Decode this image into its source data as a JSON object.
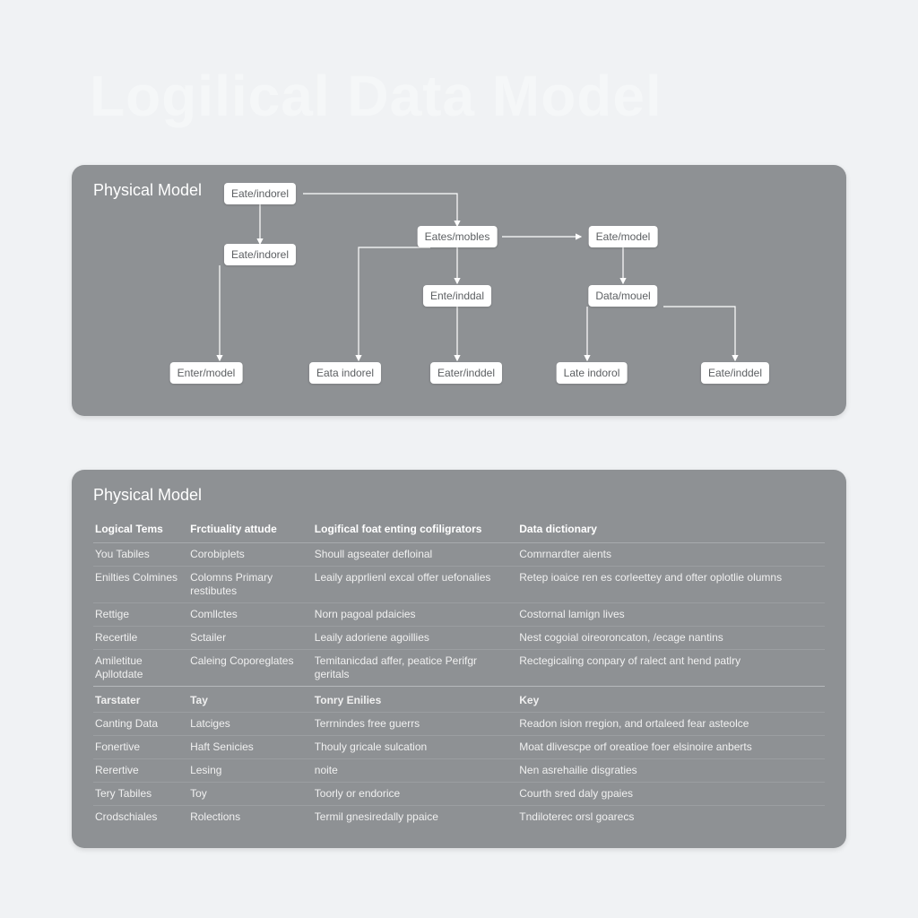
{
  "title": "Logilical Data Model",
  "diagram": {
    "title": "Physical Model",
    "nodes": {
      "n1": "Eate/indorel",
      "n2": "Eate/indorel",
      "n3": "Eates/mobles",
      "n4": "Eate/model",
      "n5": "Ente/inddal",
      "n6": "Data/mouel",
      "n7": "Enter/model",
      "n8": "Eata indorel",
      "n9": "Eater/inddel",
      "n10": "Late indorol",
      "n11": "Eate/inddel"
    }
  },
  "table": {
    "title": "Physical Model",
    "headers": [
      "Logical Tems",
      "Frctiuality attude",
      "Logifical foat enting cofiligrators",
      "Data dictionary"
    ],
    "rows": [
      {
        "section": false,
        "first": true,
        "cells": [
          "You Tabiles",
          "Corobiplets",
          "Shoull agseater defloinal",
          "Comrnardter aients"
        ]
      },
      {
        "section": false,
        "cells": [
          "Enilties Colmines",
          "Colomns Primary restibutes",
          "Leaily apprlienl excal offer uefonalies",
          "Retep ioaice ren es corleettey and ofter oplotlie olumns"
        ]
      },
      {
        "section": false,
        "cells": [
          "Rettige",
          "Comllctes",
          "Norn pagoal pdaicies",
          "Costornal lamign lives"
        ]
      },
      {
        "section": false,
        "cells": [
          "Recertile",
          "Sctailer",
          "Leaily adoriene agoillies",
          "Nest cogoial oireoroncaton, /ecage nantins"
        ]
      },
      {
        "section": false,
        "cells": [
          "Amiletitue Apllotdate",
          "Caleing Coporeglates",
          "Temitanicdad affer, peatice Perifgr geritals",
          "Rectegicaling conpary of ralect ant hend patlry"
        ]
      },
      {
        "section": true,
        "cells": [
          "Tarstater",
          "Tay",
          "Tonry Enilies",
          "Key"
        ]
      },
      {
        "section": false,
        "cells": [
          "Canting Data",
          "Latciges",
          "Terrnindes free guerrs",
          "Readon ision rregion, and ortaleed fear asteolce"
        ]
      },
      {
        "section": false,
        "cells": [
          "Fonertive",
          "Haft Senicies",
          "Thouly gricale sulcation",
          "Moat dlivescpe orf oreatioe foer elsinoire anberts"
        ]
      },
      {
        "section": false,
        "cells": [
          "Rerertive",
          "Lesing",
          "noite",
          "Nen asrehailie disgraties"
        ]
      },
      {
        "section": false,
        "cells": [
          "Tery Tabiles",
          "Toy",
          "Toorly or endorice",
          "Courth sred daly gpaies"
        ]
      },
      {
        "section": false,
        "cells": [
          "Crodschiales",
          "Rolections",
          "Termil gnesiredally ppaice",
          "Tndiloterec orsl goarecs"
        ]
      }
    ]
  }
}
